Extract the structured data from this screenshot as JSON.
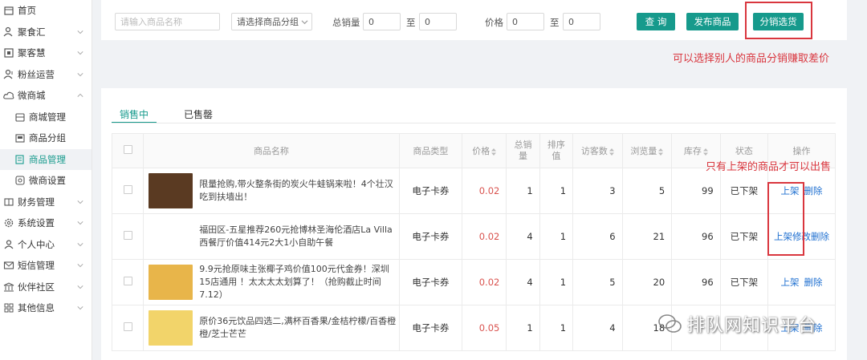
{
  "sidebar": {
    "items": [
      {
        "label": "首页",
        "icon": "home-icon",
        "level": 0,
        "chevron": false
      },
      {
        "label": "聚食汇",
        "icon": "users-icon",
        "level": 0,
        "chevron": true
      },
      {
        "label": "聚客慧",
        "icon": "grid-icon",
        "level": 0,
        "chevron": true
      },
      {
        "label": "粉丝运营",
        "icon": "fans-icon",
        "level": 0,
        "chevron": true
      },
      {
        "label": "微商城",
        "icon": "cloud-icon",
        "level": 0,
        "chevron": "up"
      },
      {
        "label": "商城管理",
        "icon": "store-icon",
        "level": 1,
        "chevron": false
      },
      {
        "label": "商品分组",
        "icon": "folder-icon",
        "level": 1,
        "chevron": false
      },
      {
        "label": "商品管理",
        "icon": "product-icon",
        "level": 1,
        "chevron": false,
        "active": true
      },
      {
        "label": "微商设置",
        "icon": "settings-icon",
        "level": 1,
        "chevron": false
      },
      {
        "label": "财务管理",
        "icon": "finance-icon",
        "level": 0,
        "chevron": true
      },
      {
        "label": "系统设置",
        "icon": "gear-icon",
        "level": 0,
        "chevron": true
      },
      {
        "label": "个人中心",
        "icon": "user-icon",
        "level": 0,
        "chevron": true
      },
      {
        "label": "短信管理",
        "icon": "mail-icon",
        "level": 0,
        "chevron": true
      },
      {
        "label": "伙伴社区",
        "icon": "bank-icon",
        "level": 0,
        "chevron": true
      },
      {
        "label": "其他信息",
        "icon": "apps-icon",
        "level": 0,
        "chevron": true
      }
    ]
  },
  "filter": {
    "name_placeholder": "请输入商品名称",
    "group_select": "请选择商品分组",
    "sales_label": "总销量",
    "sales_from": "0",
    "to1": "至",
    "sales_to": "0",
    "price_label": "价格",
    "price_from": "0",
    "to2": "至",
    "price_to": "0",
    "query_btn": "查 询",
    "publish_btn": "发布商品",
    "distribute_btn": "分销选货"
  },
  "annotations": {
    "top": "可以选择别人的商品分销赚取差价",
    "ops": "只有上架的商品才可以出售"
  },
  "tabs": [
    "销售中",
    "已售罄"
  ],
  "table": {
    "headers": [
      "商品名称",
      "商品类型",
      "价格",
      "总销量",
      "排序值",
      "访客数",
      "浏览量",
      "库存",
      "状态",
      "操作"
    ],
    "rows": [
      {
        "name": "限量抢购,带火整条街的炭火牛蛙锅来啦！4个壮汉吃到扶墙出！",
        "type": "电子卡券",
        "price": "0.02",
        "sales": "1",
        "sort": "1",
        "visitors": "3",
        "views": "5",
        "stock": "99",
        "status": "已下架",
        "op1": "上架",
        "op2": "删除",
        "thumb": "#5a3a22"
      },
      {
        "name": "福田区-五星推荐260元抢博林圣海伦酒店La Villa西餐厅价值414元2大1小自助午餐",
        "type": "电子卡券",
        "price": "0.02",
        "sales": "4",
        "sort": "1",
        "visitors": "6",
        "views": "21",
        "stock": "96",
        "status": "已下架",
        "op1": "上架",
        "op_mid": "修改",
        "op2": "删除",
        "thumb": ""
      },
      {
        "name": "9.9元抢原味主张椰子鸡价值100元代金券！深圳15店通用 ！太太太太划算了！（抢购截止时间7.12）",
        "type": "电子卡券",
        "price": "0.02",
        "sales": "4",
        "sort": "1",
        "visitors": "5",
        "views": "20",
        "stock": "96",
        "status": "已下架",
        "op1": "上架",
        "op2": "删除",
        "thumb": "#e8b54a"
      },
      {
        "name": "原价36元饮品四选二,满杯百香果/金桔柠檬/百香橙橙/芝士芒芒",
        "type": "电子卡券",
        "price": "0.05",
        "sales": "1",
        "sort": "1",
        "visitors": "4",
        "views": "18",
        "stock": "",
        "status": "",
        "op1": "上架",
        "op2": "删除",
        "thumb": "#f2d46a"
      }
    ]
  },
  "watermark": "排队网知识平台",
  "colors": {
    "accent": "#169a8c",
    "price": "#d9534f",
    "link": "#1e6fd0",
    "annotation": "#d9363e"
  }
}
